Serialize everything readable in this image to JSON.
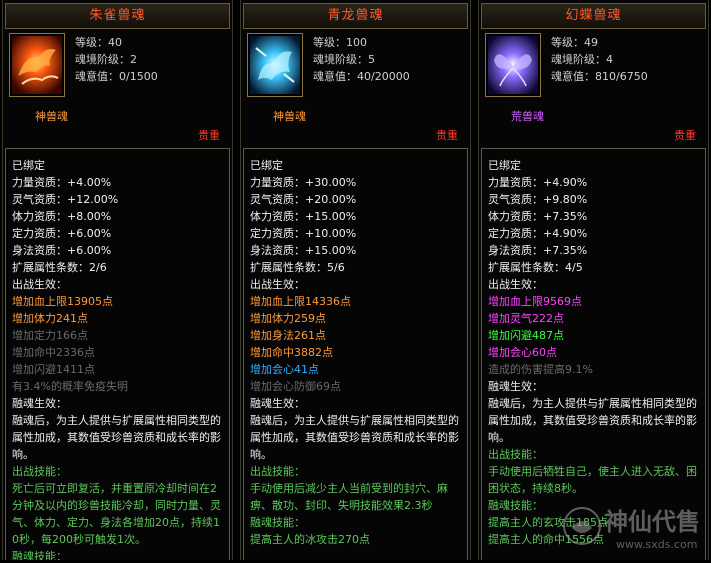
{
  "panels": [
    {
      "title": "朱雀兽魂",
      "stats": [
        "等级：40",
        "魂境阶级：2",
        "魂意值：0/1500"
      ],
      "type_label": "神兽魂",
      "type_color": "#ff9a3a",
      "rarity": "贵重",
      "icon": "vermilion-bird-icon",
      "lines": [
        {
          "t": "已绑定",
          "c": "white"
        },
        {
          "t": "力量资质：+4.00%",
          "c": "white"
        },
        {
          "t": "灵气资质：+12.00%",
          "c": "white"
        },
        {
          "t": "体力资质：+8.00%",
          "c": "white"
        },
        {
          "t": "定力资质：+6.00%",
          "c": "white"
        },
        {
          "t": "身法资质：+6.00%",
          "c": "white"
        },
        {
          "t": "扩展属性条数：2/6",
          "c": "white"
        },
        {
          "t": "出战生效：",
          "c": "white"
        },
        {
          "t": "增加血上限13905点",
          "c": "orange"
        },
        {
          "t": "增加体力241点",
          "c": "orange"
        },
        {
          "t": "增加定力166点",
          "c": "gray"
        },
        {
          "t": "增加命中2336点",
          "c": "gray"
        },
        {
          "t": "增加闪避1411点",
          "c": "gray"
        },
        {
          "t": "有3.4%的概率免疫失明",
          "c": "gray"
        },
        {
          "t": "融魂生效：",
          "c": "white"
        },
        {
          "t": "融魂后，为主人提供与扩展属性相同类型的属性加成，其数值受珍兽资质和成长率的影响。",
          "c": "white",
          "wrap": true
        },
        {
          "t": "出战技能：",
          "c": "lgreen"
        },
        {
          "t": "死亡后可立即复活，并重置原冷却时间在2分钟及以内的珍兽技能冷却，同时力量、灵气、体力、定力、身法各增加20点，持续10秒，每200秒可触发1次。",
          "c": "lgreen",
          "wrap": true
        },
        {
          "t": "融魂技能：",
          "c": "lgreen"
        }
      ]
    },
    {
      "title": "青龙兽魂",
      "stats": [
        "等级：100",
        "魂境阶级：5",
        "魂意值：40/20000"
      ],
      "type_label": "神兽魂",
      "type_color": "#ff9a3a",
      "rarity": "贵重",
      "icon": "azure-dragon-icon",
      "lines": [
        {
          "t": "已绑定",
          "c": "white"
        },
        {
          "t": "力量资质：+30.00%",
          "c": "white"
        },
        {
          "t": "灵气资质：+20.00%",
          "c": "white"
        },
        {
          "t": "体力资质：+15.00%",
          "c": "white"
        },
        {
          "t": "定力资质：+10.00%",
          "c": "white"
        },
        {
          "t": "身法资质：+15.00%",
          "c": "white"
        },
        {
          "t": "扩展属性条数：5/6",
          "c": "white"
        },
        {
          "t": "出战生效：",
          "c": "white"
        },
        {
          "t": "增加血上限14336点",
          "c": "orange"
        },
        {
          "t": "增加体力259点",
          "c": "orange"
        },
        {
          "t": "增加身法261点",
          "c": "orange"
        },
        {
          "t": "增加命中3882点",
          "c": "orange"
        },
        {
          "t": "增加会心41点",
          "c": "blue"
        },
        {
          "t": "增加会心防御69点",
          "c": "gray"
        },
        {
          "t": "融魂生效：",
          "c": "white"
        },
        {
          "t": "融魂后，为主人提供与扩展属性相同类型的属性加成，其数值受珍兽资质和成长率的影响。",
          "c": "white",
          "wrap": true
        },
        {
          "t": "出战技能：",
          "c": "lgreen"
        },
        {
          "t": "手动使用后减少主人当前受到的封穴、麻痹、散功、封印、失明技能效果2.3秒",
          "c": "lgreen",
          "wrap": true
        },
        {
          "t": "融魂技能：",
          "c": "lgreen"
        },
        {
          "t": "提高主人的冰攻击270点",
          "c": "lgreen"
        }
      ]
    },
    {
      "title": "幻蝶兽魂",
      "stats": [
        "等级：49",
        "魂境阶级：4",
        "魂意值：810/6750"
      ],
      "type_label": "荒兽魂",
      "type_color": "#d060ff",
      "rarity": "贵重",
      "icon": "phantom-butterfly-icon",
      "lines": [
        {
          "t": "已绑定",
          "c": "white"
        },
        {
          "t": "力量资质：+4.90%",
          "c": "white"
        },
        {
          "t": "灵气资质：+9.80%",
          "c": "white"
        },
        {
          "t": "体力资质：+7.35%",
          "c": "white"
        },
        {
          "t": "定力资质：+4.90%",
          "c": "white"
        },
        {
          "t": "身法资质：+7.35%",
          "c": "white"
        },
        {
          "t": "扩展属性条数：4/5",
          "c": "white"
        },
        {
          "t": "出战生效：",
          "c": "white"
        },
        {
          "t": "增加血上限9569点",
          "c": "magenta"
        },
        {
          "t": "增加灵气222点",
          "c": "magenta"
        },
        {
          "t": "增加闪避487点",
          "c": "green"
        },
        {
          "t": "增加会心60点",
          "c": "magenta"
        },
        {
          "t": "造成的伤害提高9.1%",
          "c": "gray"
        },
        {
          "t": "融魂生效：",
          "c": "white"
        },
        {
          "t": "融魂后，为主人提供与扩展属性相同类型的属性加成，其数值受珍兽资质和成长率的影响。",
          "c": "white",
          "wrap": true
        },
        {
          "t": "出战技能：",
          "c": "lgreen"
        },
        {
          "t": "手动使用后牺牲自己，使主人进入无敌、困困状态，持续8秒。",
          "c": "lgreen",
          "wrap": true
        },
        {
          "t": "融魂技能：",
          "c": "lgreen"
        },
        {
          "t": "提高主人的玄攻击185点",
          "c": "lgreen"
        },
        {
          "t": "提高主人的命中1556点",
          "c": "lgreen"
        }
      ]
    }
  ],
  "watermark": {
    "brand": "神仙代售",
    "url": "www.sxds.com"
  }
}
